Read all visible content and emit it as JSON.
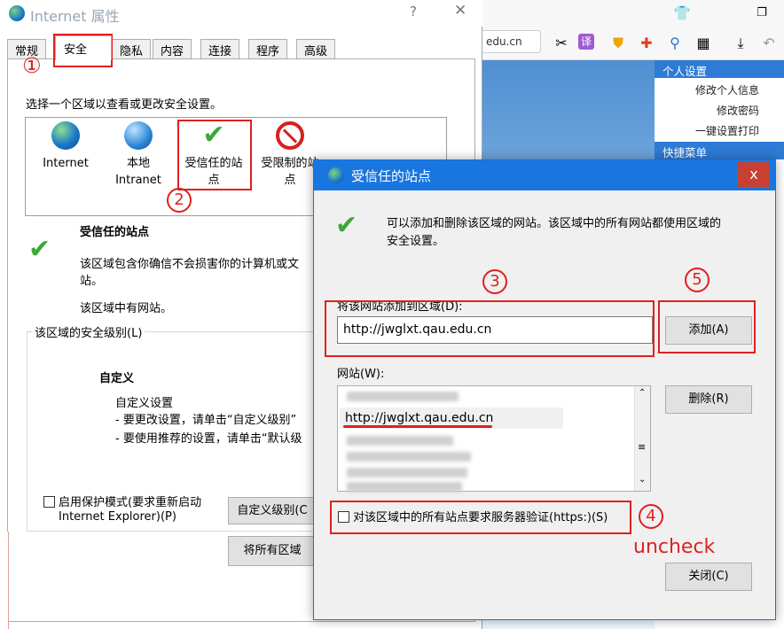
{
  "browser": {
    "address_partial": "edu.cn",
    "side_menu": {
      "header1": "个人设置",
      "items": [
        "修改个人信息",
        "修改密码",
        "一键设置打印"
      ],
      "header2": "快捷菜单"
    },
    "toolbar_icons": [
      "shirt-icon",
      "restore-icon",
      "scissors-icon",
      "translate-icon",
      "shield-icon",
      "game-icon",
      "search-icon",
      "apps-icon",
      "download-icon",
      "undo-icon"
    ]
  },
  "props": {
    "title": "Internet 属性",
    "help_glyph": "?",
    "close_glyph": "✕",
    "tabs": [
      "常规",
      "安全",
      "隐私",
      "内容",
      "连接",
      "程序",
      "高级"
    ],
    "active_tab": "安全",
    "zone_prompt": "选择一个区域以查看或更改安全设置。",
    "zones": [
      {
        "label_line1": "Internet",
        "label_line2": ""
      },
      {
        "label_line1": "本地",
        "label_line2": "Intranet"
      },
      {
        "label_line1": "受信任的站",
        "label_line2": "点"
      },
      {
        "label_line1": "受限制的站",
        "label_line2": "点"
      }
    ],
    "zone_title": "受信任的站点",
    "zone_desc_line1": "该区域包含你确信不会损害你的计算机或文",
    "zone_desc_line2": "站。",
    "zone_has_sites": "该区域中有网站。",
    "security_level_label": "该区域的安全级别(L)",
    "custom_title": "自定义",
    "custom_line1": "自定义设置",
    "custom_line2": "- 要更改设置，请单击“自定义级别”",
    "custom_line3": "- 要使用推荐的设置，请单击“默认级",
    "protected_mode_line1": "启用保护模式(要求重新启动",
    "protected_mode_line2": "Internet Explorer)(P)",
    "custom_level_button": "自定义级别(C",
    "reset_all_button": "将所有区域"
  },
  "trusted": {
    "title": "受信任的站点",
    "close_glyph": "x",
    "info_line1": "可以添加和删除该区域的网站。该区域中的所有网站都使用区域的",
    "info_line2": "安全设置。",
    "add_label": "将该网站添加到区域(D):",
    "add_input_value": "http://jwglxt.qau.edu.cn",
    "add_button": "添加(A)",
    "sites_label": "网站(W):",
    "sites_visible": "http://jwglxt.qau.edu.cn",
    "remove_button": "删除(R)",
    "https_checkbox_label": "对该区域中的所有站点要求服务器验证(https:)(S)",
    "https_checked": false,
    "close_button": "关闭(C)"
  },
  "annotations": {
    "n1": "①",
    "n2": "2",
    "n3": "3",
    "n4": "4",
    "n5": "5",
    "note": "uncheck"
  }
}
